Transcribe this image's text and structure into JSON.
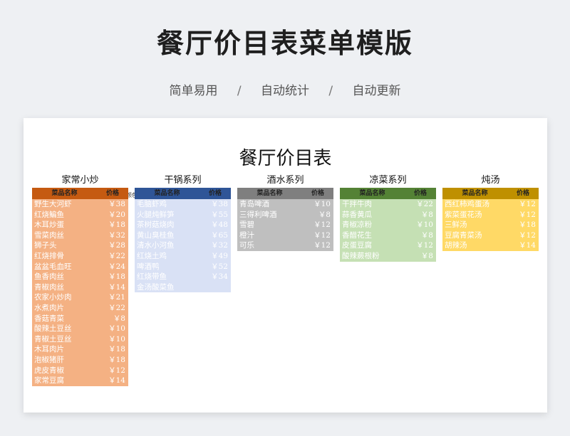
{
  "page": {
    "title": "餐厅价目表菜单模版",
    "subtitle": [
      "简单易用",
      "自动统计",
      "自动更新"
    ],
    "separator": "/"
  },
  "sheet": {
    "title": "餐厅价目表",
    "header_name": "菜品名称",
    "header_price": "价格",
    "stray_text": "颜色",
    "categories": [
      {
        "name": "家常小炒",
        "header_color": "#c55a11",
        "body_color": "#f4b183",
        "items": [
          {
            "name": "野生大河虾",
            "price": "￥38"
          },
          {
            "name": "红烧鳊鱼",
            "price": "￥20"
          },
          {
            "name": "木耳炒蛋",
            "price": "￥18"
          },
          {
            "name": "雪菜肉丝",
            "price": "￥32"
          },
          {
            "name": "狮子头",
            "price": "￥28"
          },
          {
            "name": "红烧排骨",
            "price": "￥22"
          },
          {
            "name": "盆盆毛血旺",
            "price": "￥24"
          },
          {
            "name": "鱼香肉丝",
            "price": "￥18"
          },
          {
            "name": "青椒肉丝",
            "price": "￥14"
          },
          {
            "name": "农家小炒肉",
            "price": "￥21"
          },
          {
            "name": "水煮肉片",
            "price": "￥22"
          },
          {
            "name": "香菇青菜",
            "price": "￥8"
          },
          {
            "name": "酸辣土豆丝",
            "price": "￥10"
          },
          {
            "name": "青椒土豆丝",
            "price": "￥10"
          },
          {
            "name": "木耳肉片",
            "price": "￥18"
          },
          {
            "name": "泡椒猪肝",
            "price": "￥18"
          },
          {
            "name": "虎皮青椒",
            "price": "￥12"
          },
          {
            "name": "家常豆腐",
            "price": "￥14"
          }
        ]
      },
      {
        "name": "干锅系列",
        "header_color": "#2f5597",
        "body_color": "#d9e1f5",
        "items": [
          {
            "name": "毛脑虾鸡",
            "price": "￥38"
          },
          {
            "name": "火腿炖鲜笋",
            "price": "￥55"
          },
          {
            "name": "茶树菇烧肉",
            "price": "￥48"
          },
          {
            "name": "黄山臭桂鱼",
            "price": "￥65"
          },
          {
            "name": "清水小河鱼",
            "price": "￥32"
          },
          {
            "name": "红烧土鸡",
            "price": "￥49"
          },
          {
            "name": "啤酒鸭",
            "price": "￥52"
          },
          {
            "name": "红烧带鱼",
            "price": "￥34"
          },
          {
            "name": "金汤酸菜鱼",
            "price": ""
          }
        ]
      },
      {
        "name": "酒水系列",
        "header_color": "#7f7f7f",
        "body_color": "#bfbfbf",
        "items": [
          {
            "name": "青岛啤酒",
            "price": "￥10"
          },
          {
            "name": "三得利啤酒",
            "price": "￥8"
          },
          {
            "name": "雪碧",
            "price": "￥12"
          },
          {
            "name": "橙汁",
            "price": "￥12"
          },
          {
            "name": "可乐",
            "price": "￥12"
          }
        ]
      },
      {
        "name": "凉菜系列",
        "header_color": "#548235",
        "body_color": "#c5e0b4",
        "items": [
          {
            "name": "干拌牛肉",
            "price": "￥22"
          },
          {
            "name": "蒜香黄瓜",
            "price": "￥8"
          },
          {
            "name": "青椒凉粉",
            "price": "￥10"
          },
          {
            "name": "香醋花生",
            "price": "￥8"
          },
          {
            "name": "皮蛋豆腐",
            "price": "￥12"
          },
          {
            "name": "酸辣蕨根粉",
            "price": "￥8"
          }
        ]
      },
      {
        "name": "炖汤",
        "header_color": "#bf9000",
        "body_color": "#ffd966",
        "items": [
          {
            "name": "西红柿鸡蛋汤",
            "price": "￥12"
          },
          {
            "name": "紫菜蛋花汤",
            "price": "￥12"
          },
          {
            "name": "三鲜汤",
            "price": "￥18"
          },
          {
            "name": "豆腐青菜汤",
            "price": "￥12"
          },
          {
            "name": "胡辣汤",
            "price": "￥14"
          }
        ]
      }
    ]
  }
}
